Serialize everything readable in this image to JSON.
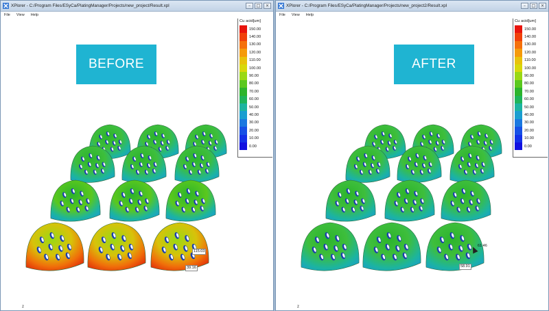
{
  "windows": [
    {
      "title": "XPlorer - C:/Program Files/ESyCa/PlatingManager/Projects/new_project/Result.xpl",
      "menu": [
        "File",
        "View",
        "Help"
      ],
      "banner": "BEFORE",
      "legend": {
        "title": "Cu acid[um]",
        "levels": [
          "150.00",
          "140.00",
          "130.00",
          "120.00",
          "110.00",
          "100.00",
          "90.00",
          "80.00",
          "70.00",
          "60.00",
          "50.00",
          "40.00",
          "30.00",
          "20.00",
          "10.00",
          "0.00"
        ]
      },
      "labels": [
        "115.03",
        "39.16"
      ],
      "axis": "z"
    },
    {
      "title": "XPlorer - C:/Program Files/ESyCa/PlatingManager/Projects/new_project2/Result.xpl",
      "menu": [
        "File",
        "View",
        "Help"
      ],
      "banner": "AFTER",
      "legend": {
        "title": "Cu acid[um]",
        "levels": [
          "150.00",
          "140.00",
          "130.00",
          "120.00",
          "110.00",
          "100.00",
          "90.00",
          "80.00",
          "70.00",
          "60.00",
          "50.00",
          "40.00",
          "30.00",
          "20.00",
          "10.00",
          "0.00"
        ]
      },
      "labels": [
        "61.46",
        "58.91"
      ],
      "axis": "z"
    }
  ],
  "colors": {
    "banner": "#1fb4d2",
    "scale": [
      "#e8140c",
      "#f0400a",
      "#f5700a",
      "#f59a0a",
      "#e8c20a",
      "#d8d80a",
      "#9ad814",
      "#5ac81e",
      "#2cb42c",
      "#1eb45a",
      "#1cb4a0",
      "#1a9ed0",
      "#1a78e0",
      "#1650e6",
      "#1230e8",
      "#1010e0"
    ]
  },
  "icons": {
    "app": "xplorer-icon",
    "minimize": "minimize-icon",
    "maximize": "maximize-icon",
    "close": "close-icon"
  }
}
